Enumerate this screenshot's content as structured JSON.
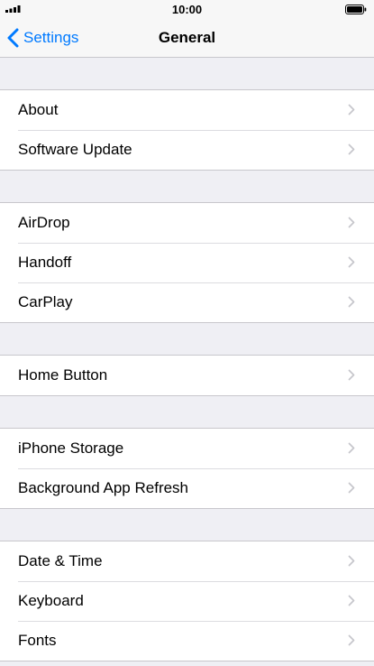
{
  "status_bar": {
    "time": "10:00",
    "signal_icon": "cellular-signal-icon",
    "battery_icon": "battery-icon"
  },
  "nav": {
    "back_label": "Settings",
    "title": "General",
    "accent_color": "#007aff"
  },
  "groups": [
    {
      "items": [
        {
          "label": "About"
        },
        {
          "label": "Software Update"
        }
      ]
    },
    {
      "items": [
        {
          "label": "AirDrop"
        },
        {
          "label": "Handoff"
        },
        {
          "label": "CarPlay"
        }
      ]
    },
    {
      "items": [
        {
          "label": "Home Button"
        }
      ]
    },
    {
      "items": [
        {
          "label": "iPhone Storage"
        },
        {
          "label": "Background App Refresh"
        }
      ]
    },
    {
      "items": [
        {
          "label": "Date & Time"
        },
        {
          "label": "Keyboard"
        },
        {
          "label": "Fonts"
        }
      ]
    }
  ]
}
